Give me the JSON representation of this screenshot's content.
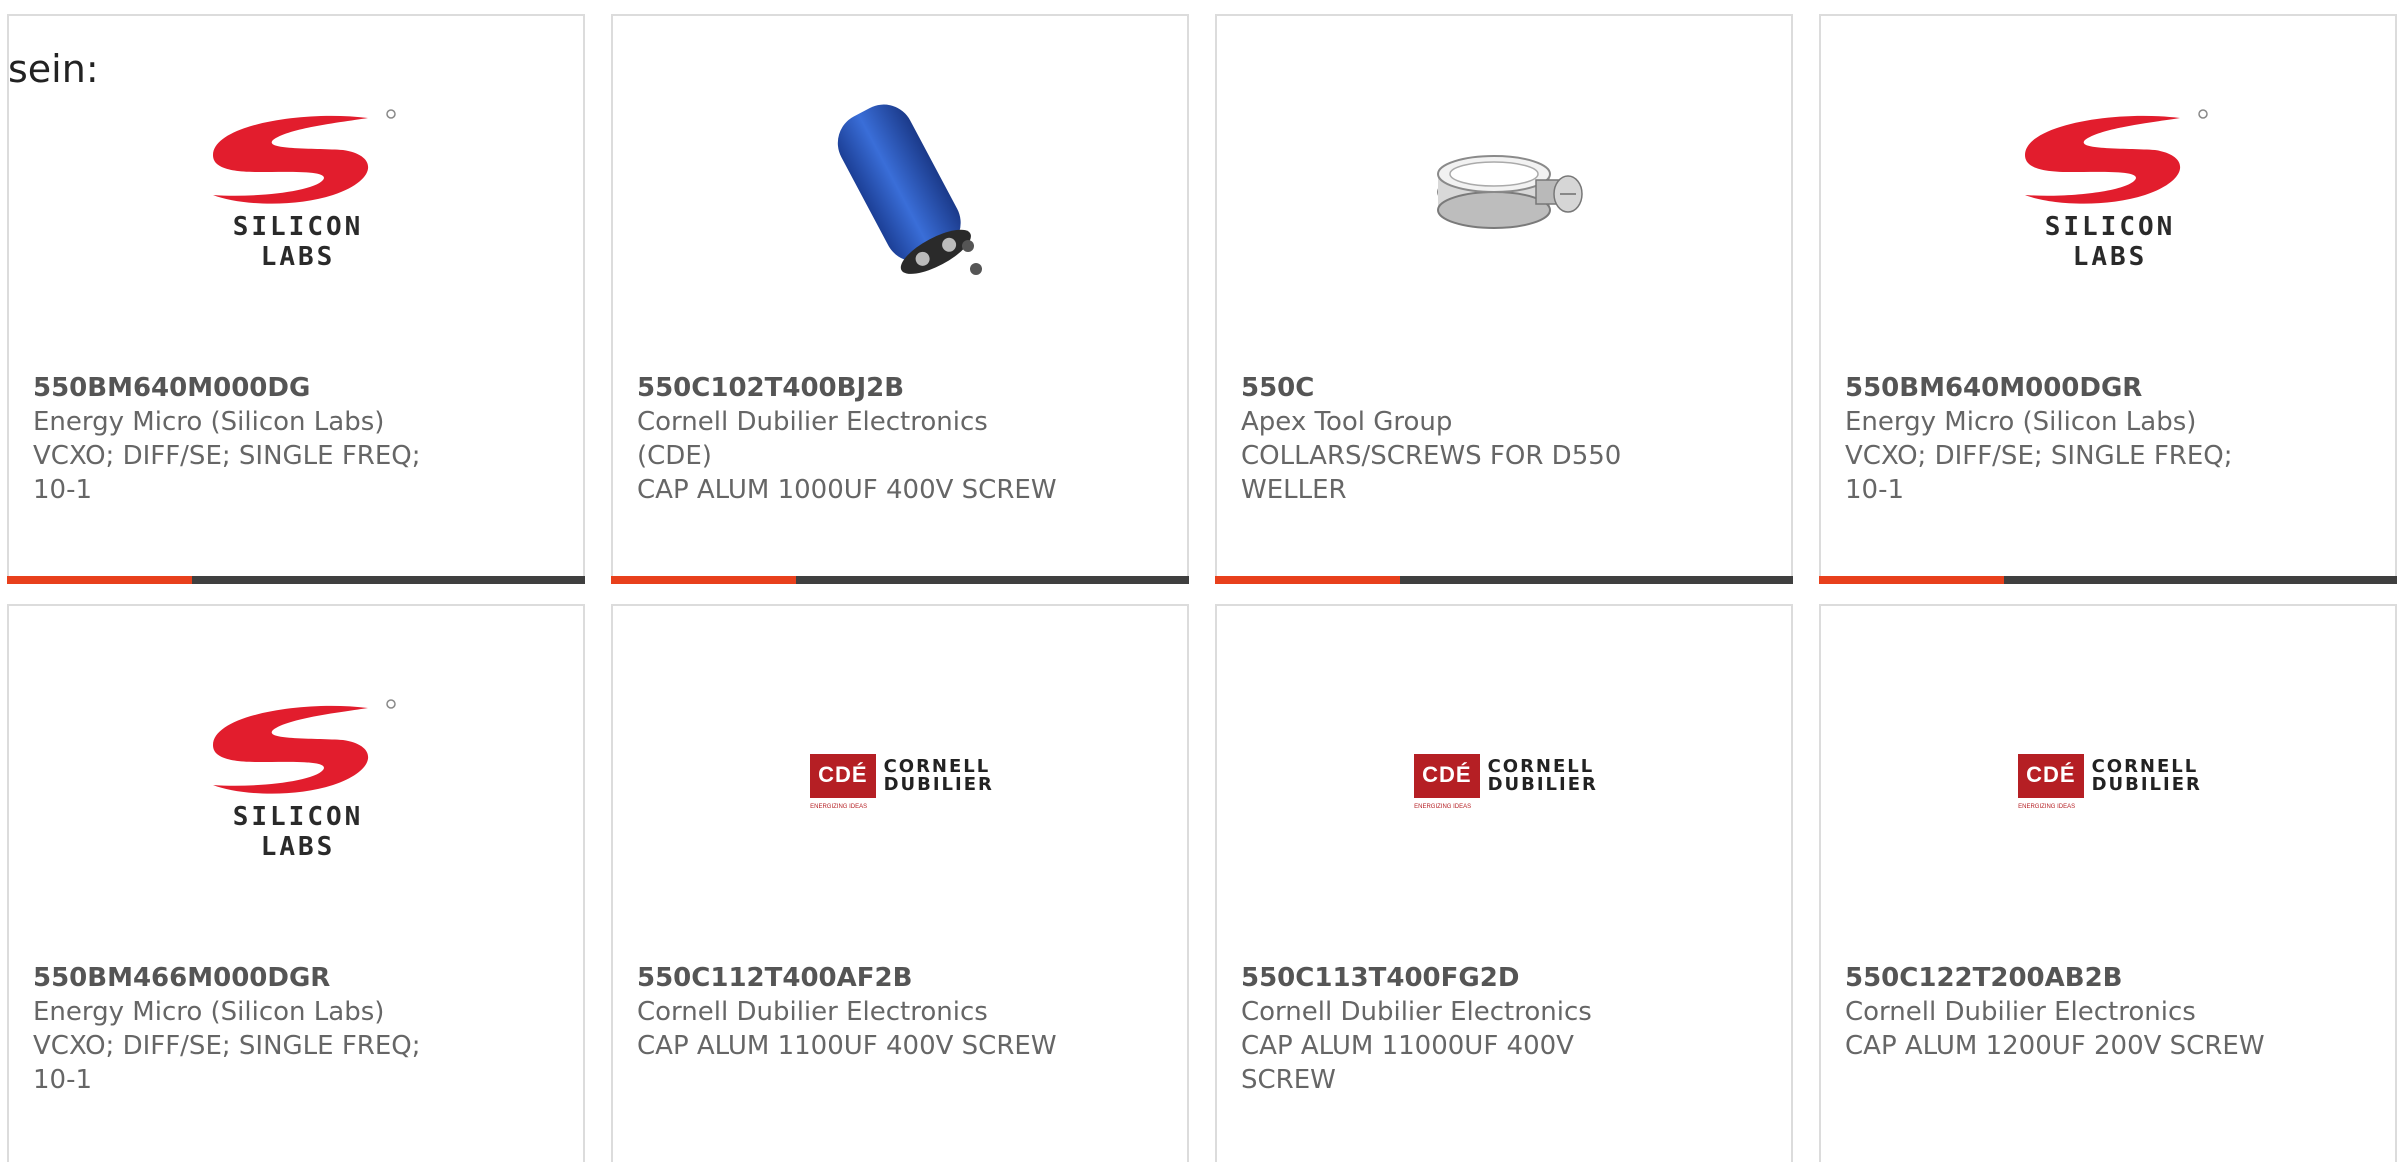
{
  "intro_text": "sein:",
  "colors": {
    "progress_accent": "#e8401c",
    "progress_track": "#3f3f3f",
    "silicon_labs_red": "#e21d2d",
    "cde_red": "#b51f24",
    "capacitor_blue": "#2c5cc6"
  },
  "cards": [
    {
      "part_number": "550BM640M000DG",
      "manufacturer": "Energy Micro (Silicon Labs)",
      "description": "VCXO; DIFF/SE; SINGLE FREQ; 10-1",
      "image": "silicon-labs-logo",
      "logo_text": "SILICON LABS",
      "progress": 0.32
    },
    {
      "part_number": "550C102T400BJ2B",
      "manufacturer": "Cornell Dubilier Electronics (CDE)",
      "description": "CAP ALUM 1000UF 400V SCREW",
      "image": "capacitor-photo",
      "progress": 0.32
    },
    {
      "part_number": "550C",
      "manufacturer": "Apex Tool Group",
      "description": "COLLARS/SCREWS FOR D550 WELLER",
      "image": "collar-screw-photo",
      "progress": 0.32
    },
    {
      "part_number": "550BM640M000DGR",
      "manufacturer": "Energy Micro (Silicon Labs)",
      "description": "VCXO; DIFF/SE; SINGLE FREQ; 10-1",
      "image": "silicon-labs-logo",
      "logo_text": "SILICON LABS",
      "progress": 0.32
    },
    {
      "part_number": "550BM466M000DGR",
      "manufacturer": "Energy Micro (Silicon Labs)",
      "description": "VCXO; DIFF/SE; SINGLE FREQ; 10-1",
      "image": "silicon-labs-logo",
      "logo_text": "SILICON LABS"
    },
    {
      "part_number": "550C112T400AF2B",
      "manufacturer": "Cornell Dubilier Electronics",
      "description": "CAP ALUM 1100UF 400V SCREW",
      "image": "cornell-dubilier-logo",
      "logo_badge": "CDÉ",
      "logo_line1": "CORNELL",
      "logo_line2": "DUBILIER",
      "logo_tagline": "ENERGIZING IDEAS"
    },
    {
      "part_number": "550C113T400FG2D",
      "manufacturer": "Cornell Dubilier Electronics",
      "description": "CAP ALUM 11000UF 400V SCREW",
      "image": "cornell-dubilier-logo",
      "logo_badge": "CDÉ",
      "logo_line1": "CORNELL",
      "logo_line2": "DUBILIER",
      "logo_tagline": "ENERGIZING IDEAS"
    },
    {
      "part_number": "550C122T200AB2B",
      "manufacturer": "Cornell Dubilier Electronics",
      "description": "CAP ALUM 1200UF 200V SCREW",
      "image": "cornell-dubilier-logo",
      "logo_badge": "CDÉ",
      "logo_line1": "CORNELL",
      "logo_line2": "DUBILIER",
      "logo_tagline": "ENERGIZING IDEAS"
    }
  ]
}
